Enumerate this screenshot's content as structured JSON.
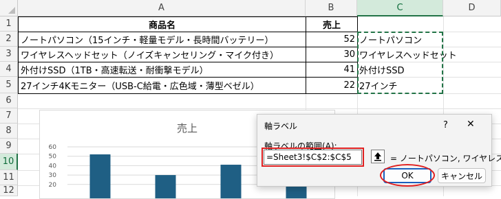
{
  "columns": [
    "A",
    "B",
    "C",
    "D"
  ],
  "rows": [
    "1",
    "2",
    "3",
    "4",
    "5",
    "6",
    "7",
    "8",
    "9",
    "10",
    "11",
    "12"
  ],
  "selected_column": "C",
  "selected_row": "10",
  "table": {
    "headers": [
      "商品名",
      "売上"
    ],
    "rows": [
      {
        "name": "ノートパソコン（15インチ・軽量モデル・長時間バッテリー）",
        "sales": "52",
        "label": "ノートパソコン"
      },
      {
        "name": "ワイヤレスヘッドセット（ノイズキャンセリング・マイク付き）",
        "sales": "30",
        "label": "ワイヤレスヘッドセット"
      },
      {
        "name": "外付けSSD（1TB・高速転送・耐衝撃モデル）",
        "sales": "41",
        "label": "外付けSSD"
      },
      {
        "name": "27インチ4Kモニター（USB-C給電・広色域・薄型ベゼル）",
        "sales": "22",
        "label": "27インチ"
      }
    ]
  },
  "chart_data": {
    "type": "bar",
    "title": "売上",
    "categories": [
      "ノートパソコン",
      "ワイヤレスヘッドセット",
      "外付けSSD",
      "27インチ"
    ],
    "values": [
      52,
      30,
      41,
      22
    ],
    "ylim": [
      0,
      60
    ],
    "yticks": [
      "60",
      "50",
      "40",
      "30",
      "20"
    ],
    "bar_color": "#1f5f84",
    "grid": true
  },
  "dialog": {
    "title": "軸ラベル",
    "help": "?",
    "close": "✕",
    "range_label": "軸ラベルの範囲(A):",
    "range_value": "=Sheet3!$C$2:$C$5",
    "collapse_icon": "collapse-up-arrow-icon",
    "preview": "= ノートパソコン, ワイヤレス...",
    "ok": "OK",
    "cancel": "キャンセル"
  },
  "colors": {
    "accent_green": "#217346",
    "highlight_red": "#e02020",
    "marquee": "#217346"
  }
}
